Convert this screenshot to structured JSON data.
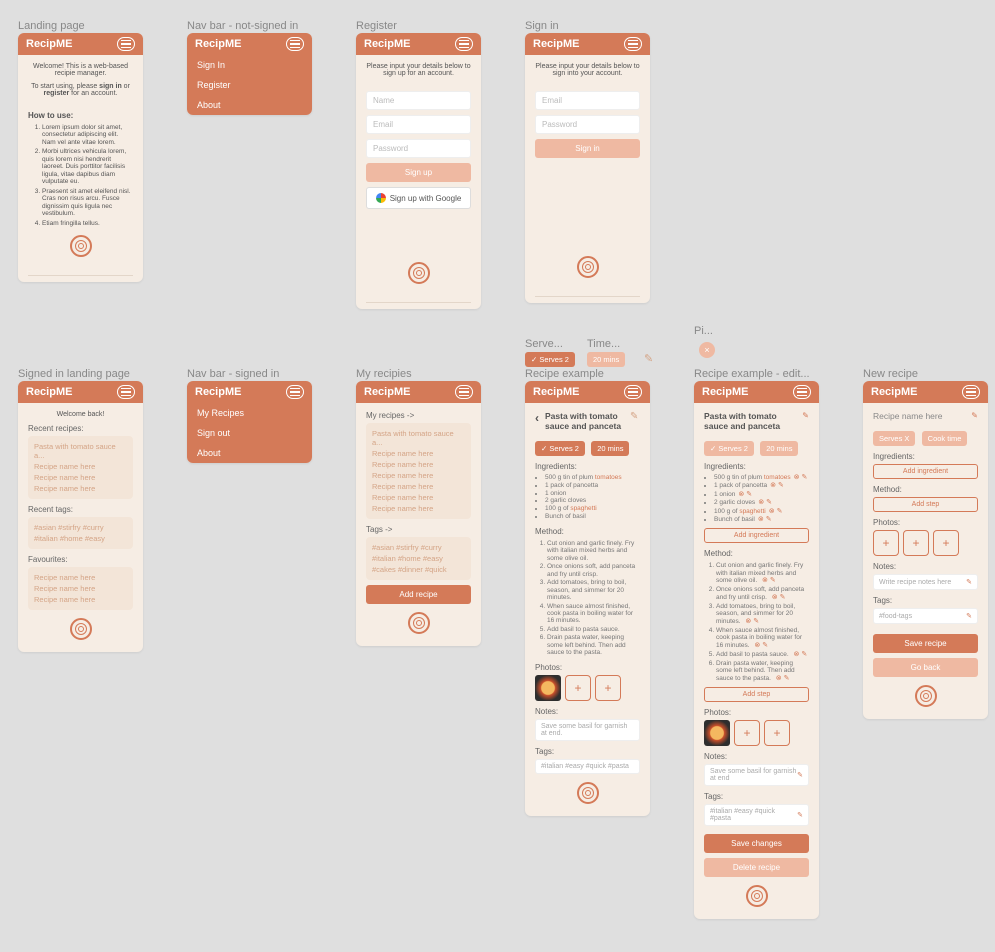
{
  "brand": "RecipME",
  "frames": {
    "landing": "Landing page",
    "nav_out": "Nav bar - not-signed in",
    "register": "Register",
    "signin": "Sign in",
    "signed_landing": "Signed in landing page",
    "nav_in": "Nav bar - signed in",
    "my_recipes": "My recipies",
    "serves": "Serve...",
    "time": "Time...",
    "pi": "Pi...",
    "recipe_ex": "Recipe example",
    "recipe_edit": "Recipe example - edit...",
    "new_recipe": "New recipe"
  },
  "landing": {
    "welcome": "Welcome! This is a web-based recipie manager.",
    "start_pre": "To start using, please ",
    "signin": "sign in",
    "or": " or ",
    "register": "register",
    "post": " for an account.",
    "how_label": "How to use:",
    "steps": [
      "Lorem ipsum dolor sit amet, consectetur adipiscing elit. Nam vel ante vitae lorem.",
      "Morbi ultrices vehicula lorem, quis lorem nisi hendrerit laoreet. Duis porttitor facilisis ligula, vitae dapibus diam vulputate eu.",
      "Praesent sit amet eleifend nisl. Cras non risus arcu. Fusce dignissim quis ligula nec vestibulum.",
      "Etiam fringilla tellus."
    ]
  },
  "nav_out": {
    "items": [
      "Sign In",
      "Register",
      "About"
    ]
  },
  "nav_in": {
    "items": [
      "My Recipes",
      "Sign out",
      "About"
    ]
  },
  "register": {
    "prompt": "Please input your details below to sign up for an account.",
    "name_ph": "Name",
    "email_ph": "Email",
    "password_ph": "Password",
    "signup": "Sign up",
    "google": "Sign up with Google"
  },
  "signin": {
    "prompt": "Please input your details below to sign into your account.",
    "email_ph": "Email",
    "password_ph": "Password",
    "signin": "Sign in"
  },
  "signed": {
    "welcome": "Welcome back!",
    "recent_label": "Recent recipes:",
    "recent": [
      "Pasta with tomato sauce a...",
      "Recipe name here",
      "Recipe name here",
      "Recipe name here"
    ],
    "tags_label": "Recent tags:",
    "tags_line1": "#asian #stirfry #curry",
    "tags_line2": "#italian #home #easy",
    "fav_label": "Favourites:",
    "favs": [
      "Recipe name here",
      "Recipe name here",
      "Recipe name here"
    ]
  },
  "myrecipes": {
    "header": "My recipes ->",
    "items": [
      "Pasta with tomato sauce a...",
      "Recipe name here",
      "Recipe name here",
      "Recipe name here",
      "Recipe name here",
      "Recipe name here",
      "Recipe name here"
    ],
    "tags_header": "Tags ->",
    "tags_1": "#asian #stirfry #curry",
    "tags_2": "#italian #home #easy",
    "tags_3": "#cakes #dinner #quick",
    "add": "Add recipe"
  },
  "chips": {
    "serves": "✓ Serves 2",
    "time": "20 mins",
    "x": "×"
  },
  "recipe": {
    "title": "Pasta with tomato sauce and panceta",
    "serves": "✓ Serves 2",
    "time": "20 mins",
    "ing_label": "Ingredients:",
    "ingredients": [
      {
        "t": "500 g tin of plum ",
        "h": "tomatoes"
      },
      {
        "t": "1 pack of pancetta",
        "h": ""
      },
      {
        "t": "1 onion",
        "h": ""
      },
      {
        "t": "2 garlic cloves",
        "h": ""
      },
      {
        "t": "100 g of ",
        "h": "spaghetti"
      },
      {
        "t": "Bunch of basil",
        "h": ""
      }
    ],
    "method_label": "Method:",
    "method": [
      "Cut onion and garlic finely. Fry with italian mixed herbs and some olive oil.",
      "Once onions soft, add panceta and fry until crisp.",
      "Add tomatoes, bring to boil, season, and simmer for 20 minutes.",
      "When sauce almost finished, cook pasta in boiling water for 16 minutes.",
      "Add basil to pasta sauce.",
      "Drain pasta water, keeping some left behind. Then add sauce to the pasta."
    ],
    "photos_label": "Photos:",
    "notes_label": "Notes:",
    "notes": "Save some basil for garnish at end.",
    "tags_label": "Tags:",
    "tags": "#italian #easy #quick #pasta"
  },
  "recipe_edit": {
    "add_ingredient": "Add ingredient",
    "add_step": "Add step",
    "save": "Save changes",
    "delete": "Delete recipe",
    "notes": "Save some basil for garnish at end"
  },
  "new_recipe": {
    "title_ph": "Recipe name here",
    "serves_ph": "Serves X",
    "cook_ph": "Cook time",
    "ing_label": "Ingredients:",
    "add_ing": "Add ingredient",
    "method_label": "Method:",
    "add_step": "Add step",
    "photos_label": "Photos:",
    "notes_label": "Notes:",
    "notes_ph": "Write recipe notes here",
    "tags_label": "Tags:",
    "tags_ph": "#food-tags",
    "save": "Save recipe",
    "back": "Go back"
  }
}
